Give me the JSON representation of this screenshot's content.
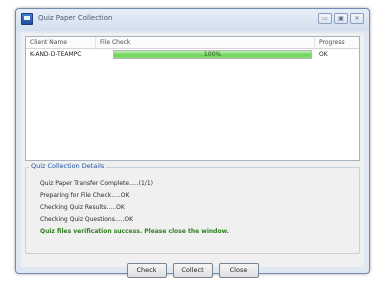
{
  "window": {
    "title": "Quiz Paper Collection",
    "controls": {
      "minimize": "▭",
      "maximize": "▣",
      "close": "✕"
    }
  },
  "list": {
    "columns": [
      "Client Name",
      "File Check",
      "Progress"
    ],
    "rows": [
      {
        "client": "K-AND-D-TEAMPC",
        "file_check_fraction": 1.0,
        "file_check_text": "100%",
        "progress": "OK"
      }
    ]
  },
  "details": {
    "heading": "Quiz Collection Details",
    "lines": [
      "Quiz Paper Transfer Complete.....(1/1)",
      "Preparing for File Check.....OK",
      "Checking Quiz Results.....OK",
      "Checking Quiz Questions.....OK"
    ],
    "success_message": "Quiz files verification success. Please close the window."
  },
  "buttons": {
    "check": "Check",
    "collect": "Collect",
    "close": "Close"
  },
  "colors": {
    "progress_fill": "#6fd35c",
    "success_text": "#2f7d1f",
    "heading_text": "#1d4fa0"
  }
}
